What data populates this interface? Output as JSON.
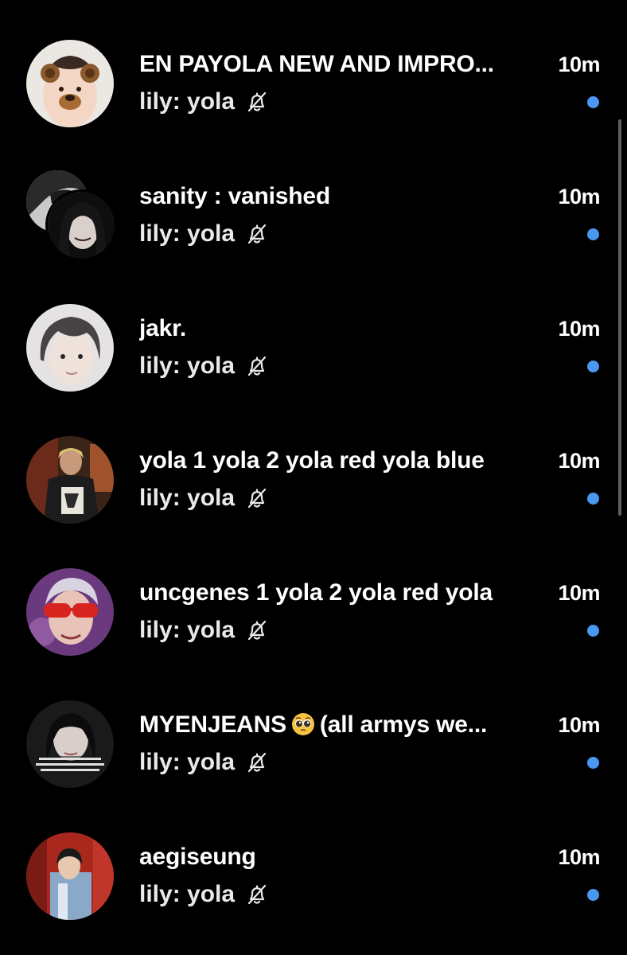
{
  "accent_color": "#4a98f1",
  "background_color": "#000000",
  "conversations": [
    {
      "title": "EN PAYOLA NEW AND IMPRO...",
      "time": "10m",
      "preview": "lily: yola",
      "muted": true,
      "unread": true,
      "avatar": "bear-filter-photo"
    },
    {
      "title": "sanity : vanished",
      "time": "10m",
      "preview": "lily: yola",
      "muted": true,
      "unread": true,
      "avatar": "group-photo-pair"
    },
    {
      "title": "jakr.",
      "time": "10m",
      "preview": "lily: yola",
      "muted": true,
      "unread": true,
      "avatar": "portrait-photo"
    },
    {
      "title": "yola 1 yola 2 yola red yola blue",
      "time": "10m",
      "preview": "lily: yola",
      "muted": true,
      "unread": true,
      "avatar": "stage-photo"
    },
    {
      "title": "uncgenes 1 yola 2 yola red yola",
      "time": "10m",
      "preview": "lily: yola",
      "muted": true,
      "unread": true,
      "avatar": "red-sunglasses-photo"
    },
    {
      "title_before_emoji": "MYENJEANS",
      "title_emoji": "pleading-face-emoji",
      "title_after_emoji": "(all armys we...",
      "time": "10m",
      "preview": "lily: yola",
      "muted": true,
      "unread": true,
      "avatar": "caption-photo"
    },
    {
      "title": "aegiseung",
      "time": "10m",
      "preview": "lily: yola",
      "muted": true,
      "unread": true,
      "avatar": "red-wall-photo"
    }
  ]
}
